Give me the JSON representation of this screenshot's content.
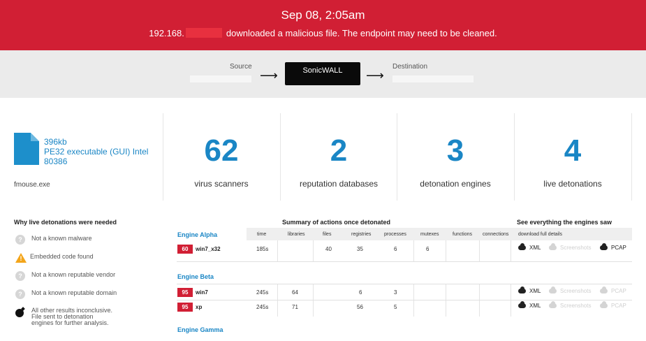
{
  "banner": {
    "time": "Sep 08, 2:05am",
    "ip_prefix": "192.168.",
    "message": "downloaded a malicious file. The endpoint may need to be cleaned.",
    "color": "#d11f34"
  },
  "flow": {
    "source_label": "Source",
    "device_label": "SonicWALL",
    "destination_label": "Destination",
    "arrow": "⟶"
  },
  "file": {
    "size": "396kb",
    "type": "PE32 executable (GUI) Intel 80386",
    "name": "fmouse.exe",
    "icon": "file-icon"
  },
  "stats": [
    {
      "value": "62",
      "label": "virus scanners"
    },
    {
      "value": "2",
      "label": "reputation databases"
    },
    {
      "value": "3",
      "label": "detonation engines"
    },
    {
      "value": "4",
      "label": "live detonations"
    }
  ],
  "why": {
    "title": "Why live detonations were needed",
    "items": [
      {
        "icon": "question-icon",
        "text": "Not a known malware"
      },
      {
        "icon": "warning-icon",
        "text": "Embedded code found"
      },
      {
        "icon": "question-icon",
        "text": "Not a known reputable vendor"
      },
      {
        "icon": "question-icon",
        "text": "Not a known reputable domain"
      },
      {
        "icon": "bomb-icon",
        "text": "All other results inconclusive. File sent to detonation engines for further analysis."
      }
    ]
  },
  "summary": {
    "title": "Summary of actions once detonated",
    "see_title": "See everything the engines saw",
    "headers": {
      "time": "time",
      "libraries": "libraries",
      "files": "files",
      "registries": "registries",
      "processes": "processes",
      "mutexes": "mutexes",
      "functions": "functions",
      "connections": "connections",
      "download": "download full details"
    },
    "engines": [
      {
        "name": "Engine Alpha",
        "rows": [
          {
            "score": "60",
            "os": "win7_x32",
            "time": "185s",
            "libraries": "",
            "files": "40",
            "registries": "35",
            "processes": "6",
            "mutexes": "6",
            "functions": "",
            "connections": "",
            "downloads": [
              {
                "label": "XML",
                "active": true
              },
              {
                "label": "Screenshots",
                "active": false
              },
              {
                "label": "PCAP",
                "active": true
              }
            ]
          }
        ]
      },
      {
        "name": "Engine Beta",
        "rows": [
          {
            "score": "95",
            "os": "win7",
            "time": "245s",
            "libraries": "64",
            "files": "",
            "registries": "6",
            "processes": "3",
            "mutexes": "",
            "functions": "",
            "connections": "",
            "downloads": [
              {
                "label": "XML",
                "active": true
              },
              {
                "label": "Screenshots",
                "active": false
              },
              {
                "label": "PCAP",
                "active": false
              }
            ]
          },
          {
            "score": "95",
            "os": "xp",
            "time": "245s",
            "libraries": "71",
            "files": "",
            "registries": "56",
            "processes": "5",
            "mutexes": "",
            "functions": "",
            "connections": "",
            "downloads": [
              {
                "label": "XML",
                "active": true
              },
              {
                "label": "Screenshots",
                "active": false
              },
              {
                "label": "PCAP",
                "active": false
              }
            ]
          }
        ]
      },
      {
        "name": "Engine Gamma",
        "rows": []
      }
    ]
  }
}
